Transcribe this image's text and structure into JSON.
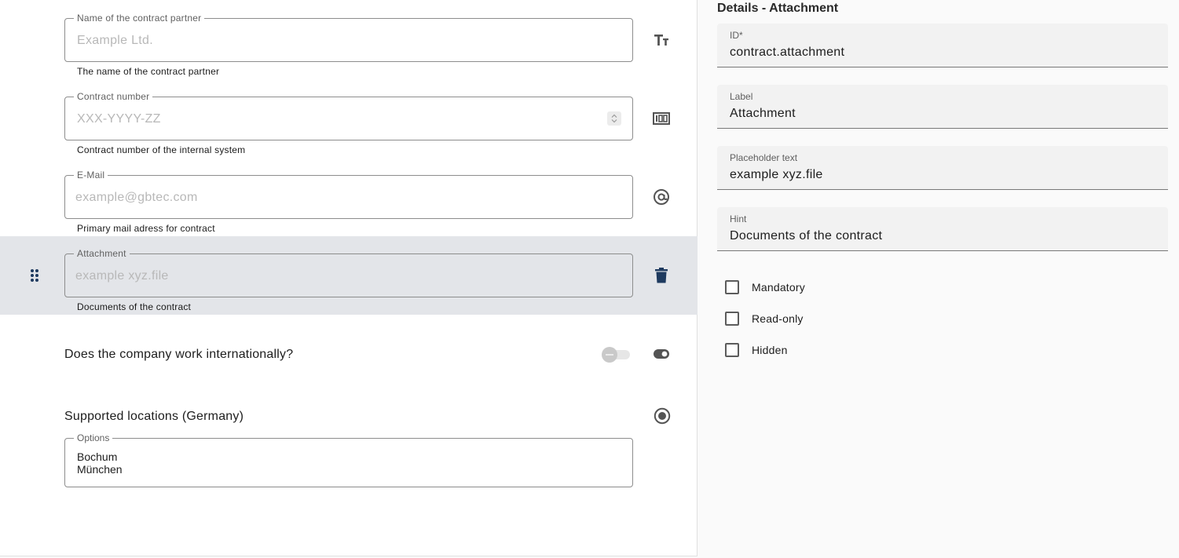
{
  "canvas": {
    "fields": [
      {
        "label": "Name of the contract partner",
        "placeholder": "Example Ltd.",
        "hint": "The name of the contract partner",
        "type_icon": "text-size-icon"
      },
      {
        "label": "Contract number",
        "placeholder": "XXX-YYYY-ZZ",
        "hint": "Contract number of the internal system",
        "type_icon": "number-icon"
      },
      {
        "label": "E-Mail",
        "placeholder": "example@gbtec.com",
        "hint": "Primary mail adress for contract",
        "type_icon": "at-icon"
      },
      {
        "label": "Attachment",
        "placeholder": "example xyz.file",
        "hint": "Documents of the contract",
        "type_icon": "delete-icon",
        "selected": true
      }
    ],
    "toggle_question": {
      "label": "Does the company work internationally?",
      "value": false,
      "type_icon": "toggle-icon"
    },
    "radio_question": {
      "label": "Supported locations (Germany)",
      "type_icon": "radio-icon",
      "options_label": "Options",
      "options": [
        "Bochum",
        "München"
      ]
    }
  },
  "details": {
    "title": "Details - Attachment",
    "fields": [
      {
        "label": "ID*",
        "value": "contract.attachment"
      },
      {
        "label": "Label",
        "value": "Attachment"
      },
      {
        "label": "Placeholder text",
        "value": "example xyz.file"
      },
      {
        "label": "Hint",
        "value": "Documents of the contract"
      }
    ],
    "checkboxes": [
      {
        "label": "Mandatory",
        "checked": false
      },
      {
        "label": "Read-only",
        "checked": false
      },
      {
        "label": "Hidden",
        "checked": false
      }
    ]
  },
  "colors": {
    "selected_row": "#e3e5e9",
    "accent_dark": "#1e3a5f",
    "outline": "#8d8d8d"
  }
}
